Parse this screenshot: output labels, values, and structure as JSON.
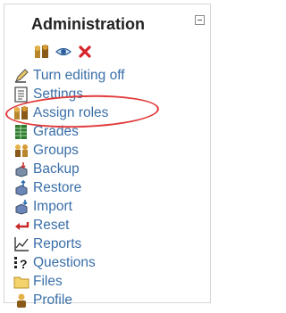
{
  "block": {
    "title": "Administration",
    "header_icons": [
      "roles-icon",
      "eye-icon",
      "delete-icon"
    ],
    "collapse_icon": "collapse-icon"
  },
  "menu": [
    {
      "label": "Turn editing off",
      "icon": "edit-icon"
    },
    {
      "label": "Settings",
      "icon": "settings-icon"
    },
    {
      "label": "Assign roles",
      "icon": "roles-icon"
    },
    {
      "label": "Grades",
      "icon": "grades-icon"
    },
    {
      "label": "Groups",
      "icon": "groups-icon"
    },
    {
      "label": "Backup",
      "icon": "backup-icon"
    },
    {
      "label": "Restore",
      "icon": "restore-icon"
    },
    {
      "label": "Import",
      "icon": "import-icon"
    },
    {
      "label": "Reset",
      "icon": "reset-icon"
    },
    {
      "label": "Reports",
      "icon": "reports-icon"
    },
    {
      "label": "Questions",
      "icon": "questions-icon"
    },
    {
      "label": "Files",
      "icon": "folder-icon"
    },
    {
      "label": "Profile",
      "icon": "profile-icon"
    }
  ],
  "highlight": {
    "color": "#e23a3a",
    "target": "Assign roles"
  }
}
